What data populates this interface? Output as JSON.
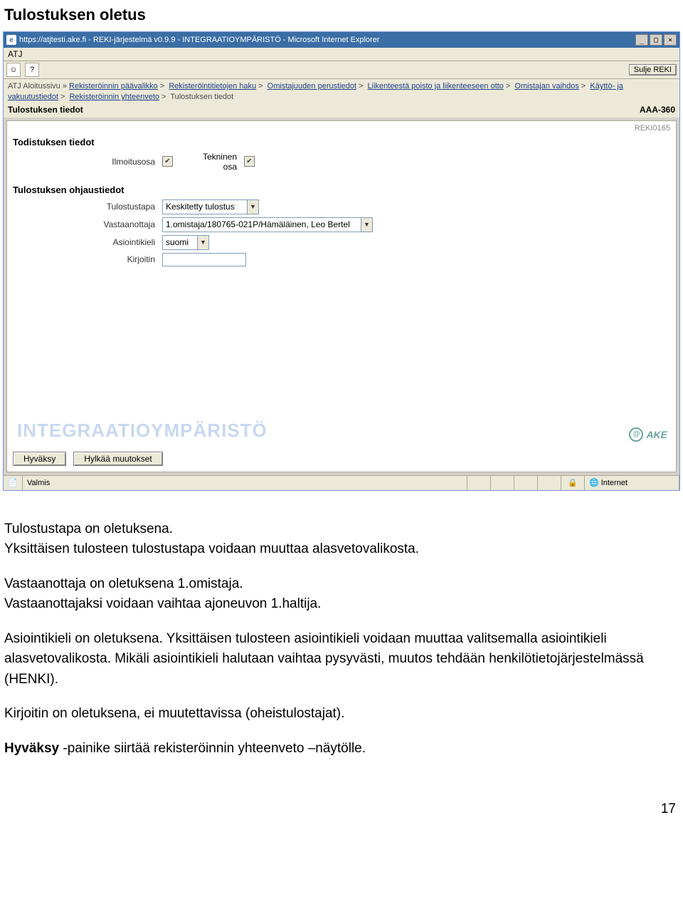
{
  "page_heading": "Tulostuksen oletus",
  "titlebar": "https://atjtesti.ake.fi - REKI-järjestelmä v0.9.9 - INTEGRAATIOYMPÄRISTÖ - Microsoft Internet Explorer",
  "title_buttons": {
    "min": "_",
    "max": "□",
    "close": "×"
  },
  "menubar": "ATJ",
  "toolbar": {
    "icon1": "☺",
    "icon2": "?",
    "sulje": "Sulje REKI"
  },
  "breadcrumb": {
    "start": "ATJ Aloitussivu »",
    "items": [
      "Rekisteröinnin päävalikko",
      "Rekisteröintitietojen haku",
      "Omistajuuden perustiedot",
      "Liikenteestä poisto ja liikenteeseen otto",
      "Omistajan vaihdos",
      "Käyttö- ja vakuutustiedot",
      "Rekisteröinnin yhteenveto"
    ],
    "current": "Tulostuksen tiedot"
  },
  "subheader": {
    "left": "Tulostuksen tiedot",
    "right": "AAA-360"
  },
  "content": {
    "code": "REKI0165",
    "sec1": "Todistuksen tiedot",
    "row1": {
      "lbl1": "Ilmoitusosa",
      "lbl2": "Tekninen osa"
    },
    "sec2": "Tulostuksen ohjaustiedot",
    "rows": {
      "tulostustapa": {
        "label": "Tulostustapa",
        "value": "Keskitetty tulostus"
      },
      "vastaanottaja": {
        "label": "Vastaanottaja",
        "value": "1.omistaja/180765-021P/Hämäläinen, Leo Bertel"
      },
      "asiointikieli": {
        "label": "Asiointikieli",
        "value": "suomi"
      },
      "kirjoitin": {
        "label": "Kirjoitin",
        "value": ""
      }
    },
    "buttons": {
      "ok": "Hyväksy",
      "cancel": "Hylkää muutokset"
    },
    "watermark": "INTEGRAATIOYMPÄRISTÖ",
    "ake": "AKE"
  },
  "statusbar": {
    "valmis": "Valmis",
    "internet": "Internet"
  },
  "body_text": {
    "p1": "Tulostustapa on oletuksena.",
    "p2": "Yksittäisen tulosteen tulostustapa voidaan muuttaa alasvetovalikosta.",
    "p3": "Vastaanottaja on oletuksena 1.omistaja.",
    "p4": "Vastaanottajaksi voidaan vaihtaa ajoneuvon 1.haltija.",
    "p5": "Asiointikieli on oletuksena. Yksittäisen tulosteen asiointikieli voidaan muuttaa valitsemalla asiointikieli alasvetovalikosta. Mikäli asiointikieli halutaan vaihtaa pysyvästi, muutos tehdään henkilötietojärjestelmässä (HENKI).",
    "p6": "Kirjoitin on oletuksena, ei muutettavissa (oheistulostajat).",
    "p7a": "Hyväksy ",
    "p7b": "-painike siirtää rekisteröinnin yhteenveto –näytölle."
  },
  "page_number": "17"
}
